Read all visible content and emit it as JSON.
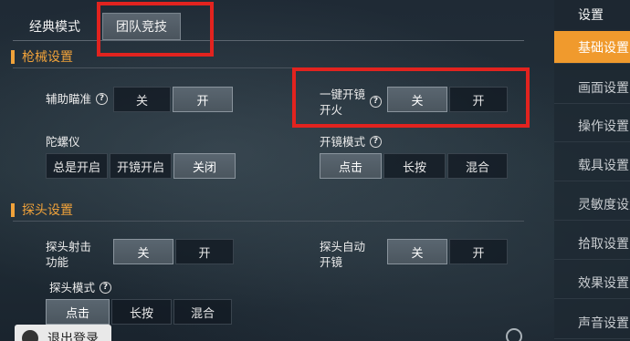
{
  "tabs": {
    "classic": "经典模式",
    "team": "团队竞技"
  },
  "sections": {
    "weapon": "枪械设置",
    "peek": "探头设置"
  },
  "settings": {
    "aim_assist": {
      "label": "辅助瞄准",
      "options": [
        "关",
        "开"
      ]
    },
    "one_key_scope_fire": {
      "label_line1": "一键开镜",
      "label_line2": "开火",
      "options": [
        "关",
        "开"
      ]
    },
    "gyroscope": {
      "label": "陀螺仪",
      "options": [
        "总是开启",
        "开镜开启",
        "关闭"
      ]
    },
    "scope_mode": {
      "label": "开镜模式",
      "options": [
        "点击",
        "长按",
        "混合"
      ]
    },
    "peek_fire": {
      "label_line1": "探头射击",
      "label_line2": "功能",
      "options": [
        "关",
        "开"
      ]
    },
    "peek_auto_scope": {
      "label_line1": "探头自动",
      "label_line2": "开镜",
      "options": [
        "关",
        "开"
      ]
    },
    "peek_mode": {
      "label": "探头模式",
      "options": [
        "点击",
        "长按",
        "混合"
      ]
    }
  },
  "sidebar": {
    "title": "设置",
    "items": [
      "基础设置",
      "画面设置",
      "操作设置",
      "载具设置",
      "灵敏度设置",
      "拾取设置",
      "效果设置",
      "声音设置"
    ]
  },
  "logout": "退出登录",
  "help_symbol": "?",
  "colors": {
    "accent": "#f09a2d",
    "highlight_box": "#e2231f"
  }
}
